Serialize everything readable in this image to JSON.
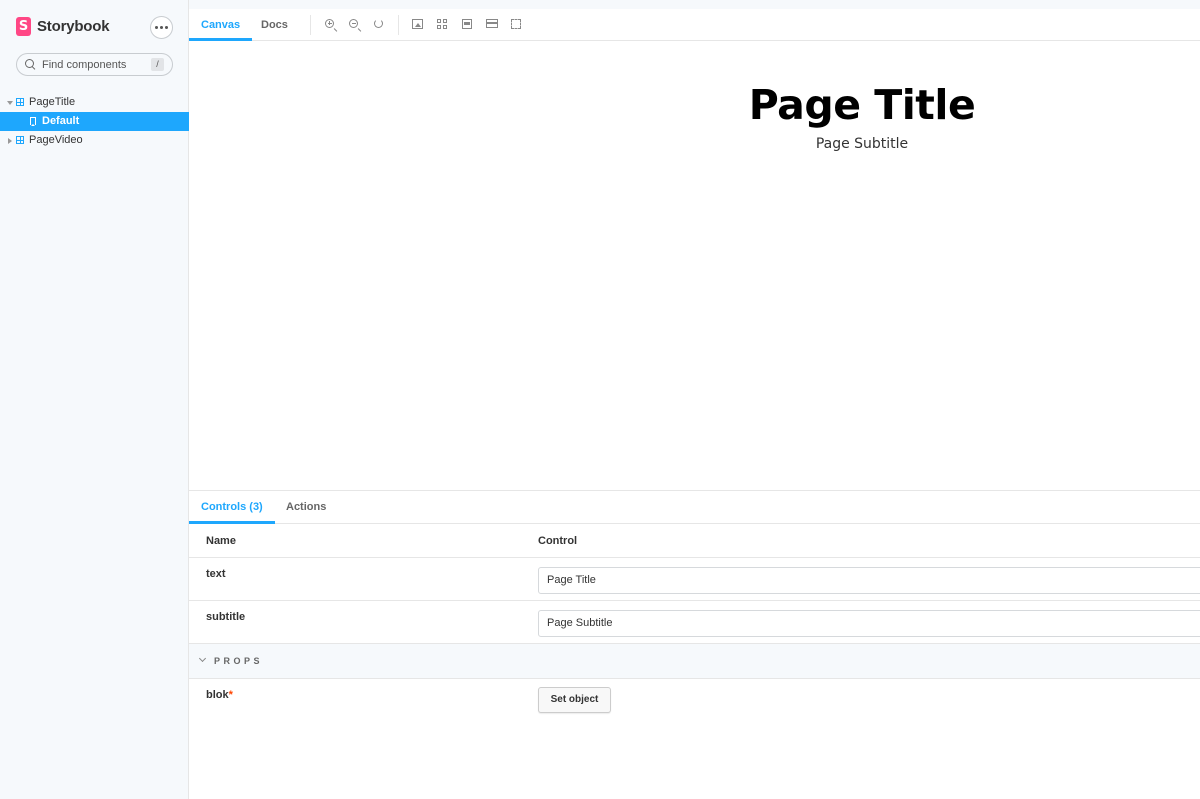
{
  "app": {
    "name": "Storybook"
  },
  "sidebar": {
    "search_placeholder": "Find components",
    "search_shortcut": "/",
    "tree": [
      {
        "label": "PageTitle",
        "expanded": true
      },
      {
        "label": "Default",
        "selected": true
      },
      {
        "label": "PageVideo",
        "expanded": false
      }
    ]
  },
  "toolbar": {
    "tabs": [
      {
        "label": "Canvas",
        "active": true
      },
      {
        "label": "Docs",
        "active": false
      }
    ],
    "tools": [
      "zoom-in-icon",
      "zoom-out-icon",
      "zoom-reset-icon",
      "image-icon",
      "grid-icon",
      "background-icon",
      "viewport-icon",
      "outline-icon"
    ]
  },
  "canvas": {
    "title": "Page Title",
    "subtitle": "Page Subtitle"
  },
  "addons": {
    "tabs": [
      {
        "label": "Controls (3)",
        "active": true
      },
      {
        "label": "Actions",
        "active": false
      }
    ],
    "columns": {
      "name": "Name",
      "control": "Control"
    },
    "rows": [
      {
        "name": "text",
        "value": "Page Title"
      },
      {
        "name": "subtitle",
        "value": "Page Subtitle"
      }
    ],
    "section": "PROPS",
    "props_rows": [
      {
        "name": "blok",
        "required_mark": "*",
        "button_label": "Set object"
      }
    ]
  },
  "colors": {
    "accent": "#1ea7fd",
    "brand": "#ff4785",
    "required": "#ff4400"
  }
}
